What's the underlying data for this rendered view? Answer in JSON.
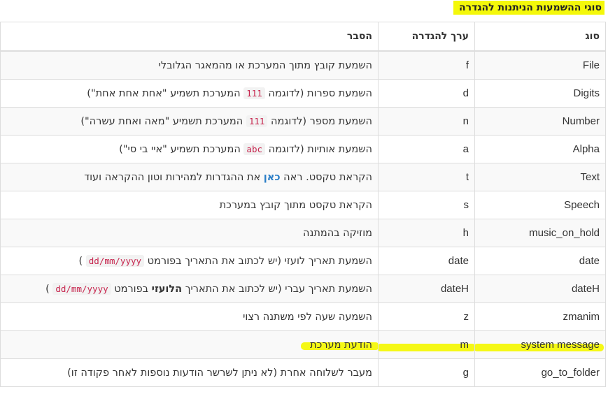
{
  "title": "סוגי ההשמעות הניתנות להגדרה",
  "columns": {
    "type": "סוג",
    "value": "ערך להגדרה",
    "explanation": "הסבר"
  },
  "rows": [
    {
      "type": "File",
      "value": "f",
      "exp": {
        "text": "השמעת קובץ מתוך המערכת או מהמאגר הגלובלי"
      }
    },
    {
      "type": "Digits",
      "value": "d",
      "exp": {
        "pre": "השמעת ספרות (לדוגמה ",
        "code": "111",
        "post": " המערכת תשמיע \"אחת אחת אחת\")"
      }
    },
    {
      "type": "Number",
      "value": "n",
      "exp": {
        "pre": "השמעת מספר (לדוגמה ",
        "code": "111",
        "post": " המערכת תשמיע \"מאה ואחת עשרה\")"
      }
    },
    {
      "type": "Alpha",
      "value": "a",
      "exp": {
        "pre": "השמעת אותיות (לדוגמה ",
        "code": "abc",
        "post": " המערכת תשמיע \"איי בי סי\")"
      }
    },
    {
      "type": "Text",
      "value": "t",
      "exp": {
        "pre": "הקראת טקסט. ראה ",
        "link": "כאן",
        "post": " את ההגדרות למהירות וטון ההקראה ועוד"
      }
    },
    {
      "type": "Speech",
      "value": "s",
      "exp": {
        "text": "הקראת טקסט מתוך קובץ במערכת"
      }
    },
    {
      "type": "music_on_hold",
      "value": "h",
      "exp": {
        "text": "מוזיקה בהמתנה"
      }
    },
    {
      "type": "date",
      "value": "date",
      "exp": {
        "pre": "השמעת תאריך לועזי (יש לכתוב את התאריך בפורמט ",
        "code": "dd/mm/yyyy",
        "post": " )"
      }
    },
    {
      "type": "dateH",
      "value": "dateH",
      "exp": {
        "pre": "השמעת תאריך עברי (יש לכתוב את התאריך ",
        "bold": "הלועזי",
        "post": " בפורמט ",
        "code": "dd/mm/yyyy",
        "post2": " )"
      }
    },
    {
      "type": "zmanim",
      "value": "z",
      "exp": {
        "text": "השמעה שעה לפי משתנה רצוי"
      }
    },
    {
      "type": "system message",
      "value": "m",
      "exp": {
        "text": "הודעת מערכת"
      },
      "highlighted": true
    },
    {
      "type": "go_to_folder",
      "value": "g",
      "exp": {
        "text": "מעבר לשלוחה אחרת (לא ניתן לשרשר הודעות נוספות לאחר פקודה זו)"
      }
    }
  ],
  "highlight_color": "#f4f80a",
  "code_color": "#c7254e",
  "link_color": "#2a7ec7"
}
